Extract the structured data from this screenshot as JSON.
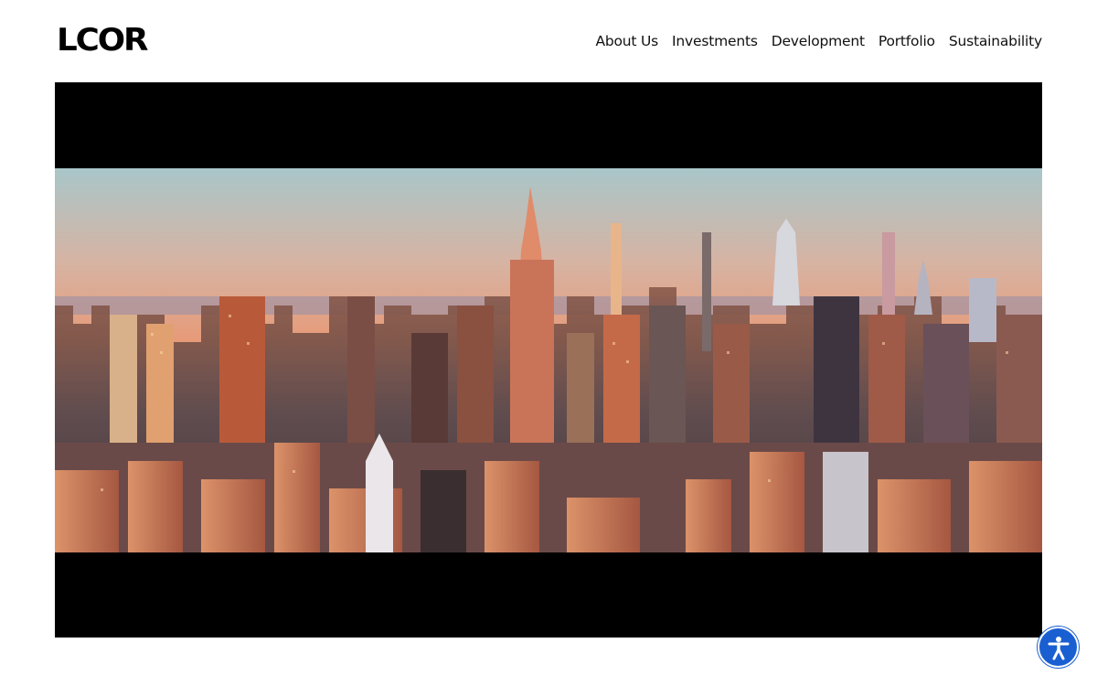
{
  "brand": {
    "logo_text": "LCOR"
  },
  "nav": {
    "items": [
      {
        "label": "About Us"
      },
      {
        "label": "Investments"
      },
      {
        "label": "Development"
      },
      {
        "label": "Portfolio"
      },
      {
        "label": "Sustainability"
      }
    ]
  },
  "hero": {
    "media_type": "video",
    "subject": "city-skyline-at-sunset"
  },
  "accessibility": {
    "icon": "accessibility-person-icon",
    "color": "#1a5fd1"
  },
  "colors": {
    "background": "#ffffff",
    "text": "#111111",
    "letterbox": "#000000",
    "accent": "#1a5fd1"
  }
}
